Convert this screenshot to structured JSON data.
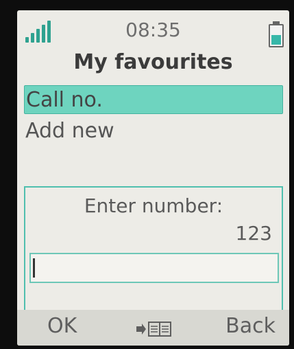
{
  "status_bar": {
    "time": "08:35",
    "signal_icon": "signal-bars-icon",
    "battery_icon": "battery-icon",
    "battery_level": 0.55,
    "signal_level": 5
  },
  "screen": {
    "title": "My favourites"
  },
  "menu": {
    "items": [
      {
        "label": "Call no.",
        "selected": true
      },
      {
        "label": "Add new",
        "selected": false
      }
    ]
  },
  "dialog": {
    "label": "Enter number:",
    "value": "123",
    "input_value": ""
  },
  "softkeys": {
    "left_label": "OK",
    "center_icon": "phonebook-icon",
    "right_label": "Back"
  },
  "colors": {
    "accent": "#6ed4bf",
    "accent_border": "#42b29f",
    "signal": "#2fa290",
    "battery_fill": "#37b7a9"
  }
}
